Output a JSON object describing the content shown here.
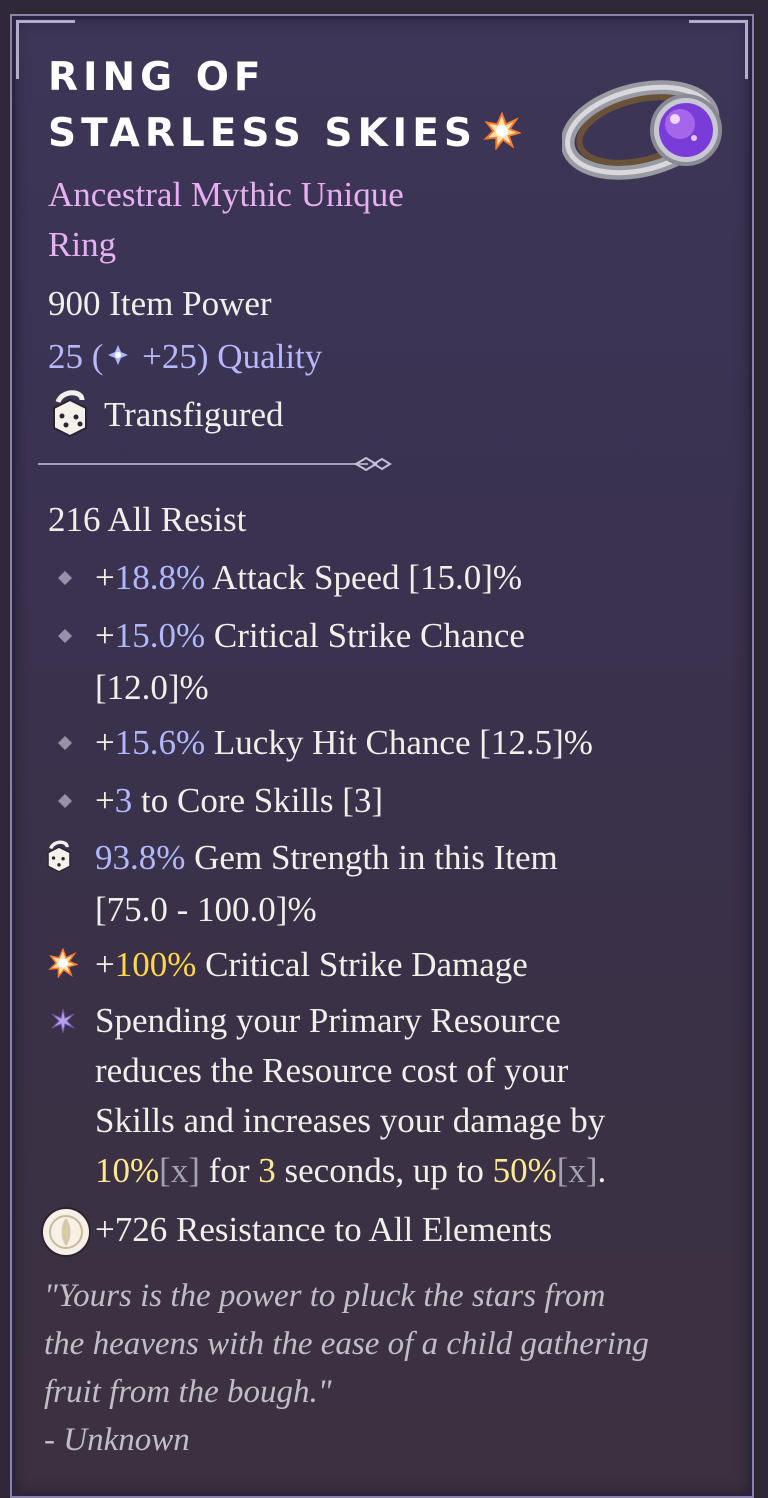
{
  "item": {
    "name_line1": "RING OF",
    "name_line2": "STARLESS SKIES",
    "rarity_line1": "Ancestral Mythic Unique",
    "rarity_line2": "Ring",
    "item_power": "900 Item Power",
    "quality_base": "25 (",
    "quality_bonus": " +25) Quality",
    "status": "Transfigured",
    "icons": {
      "title": "mythic-star-icon",
      "art": "ring-item-icon",
      "status": "transfigured-die-icon"
    }
  },
  "stats": {
    "base": "216 All Resist",
    "affixes": [
      {
        "prefix": "+",
        "value": "18.8%",
        "text": " Attack Speed [15.0]%"
      },
      {
        "prefix": "+",
        "value": "15.0%",
        "text": " Critical Strike Chance",
        "text2": "[12.0]%"
      },
      {
        "prefix": "+",
        "value": "15.6%",
        "text": " Lucky Hit Chance [12.5]%"
      },
      {
        "prefix": "+",
        "value": "3",
        "text": " to Core Skills [3]"
      }
    ],
    "gem": {
      "value": "93.8%",
      "text": " Gem Strength in this Item",
      "text2": "[75.0 - 100.0]%"
    },
    "mythic": {
      "prefix": "+",
      "value": "100%",
      "text": " Critical Strike Damage"
    },
    "unique_power": {
      "line1": "Spending your Primary Resource",
      "line2": "reduces the Resource cost of your",
      "line3": "Skills and increases your damage by",
      "v1": "10%",
      "x1": "[x]",
      "mid1": " for ",
      "v2": "3",
      "mid2": " seconds, up to ",
      "v3": "50%",
      "x2": "[x]",
      "end": "."
    },
    "resistance": "+726 Resistance to All Elements"
  },
  "flavor": {
    "line1": "\"Yours is the power to pluck the stars from",
    "line2": "the heavens with the ease of a child gathering",
    "line3": "fruit from the bough.\"",
    "author": "- Unknown"
  },
  "colors": {
    "rarity": "#e8b0f0",
    "affix_value": "#b0b8ff",
    "mythic_value": "#ffd84a",
    "panel": "#3a3250"
  }
}
